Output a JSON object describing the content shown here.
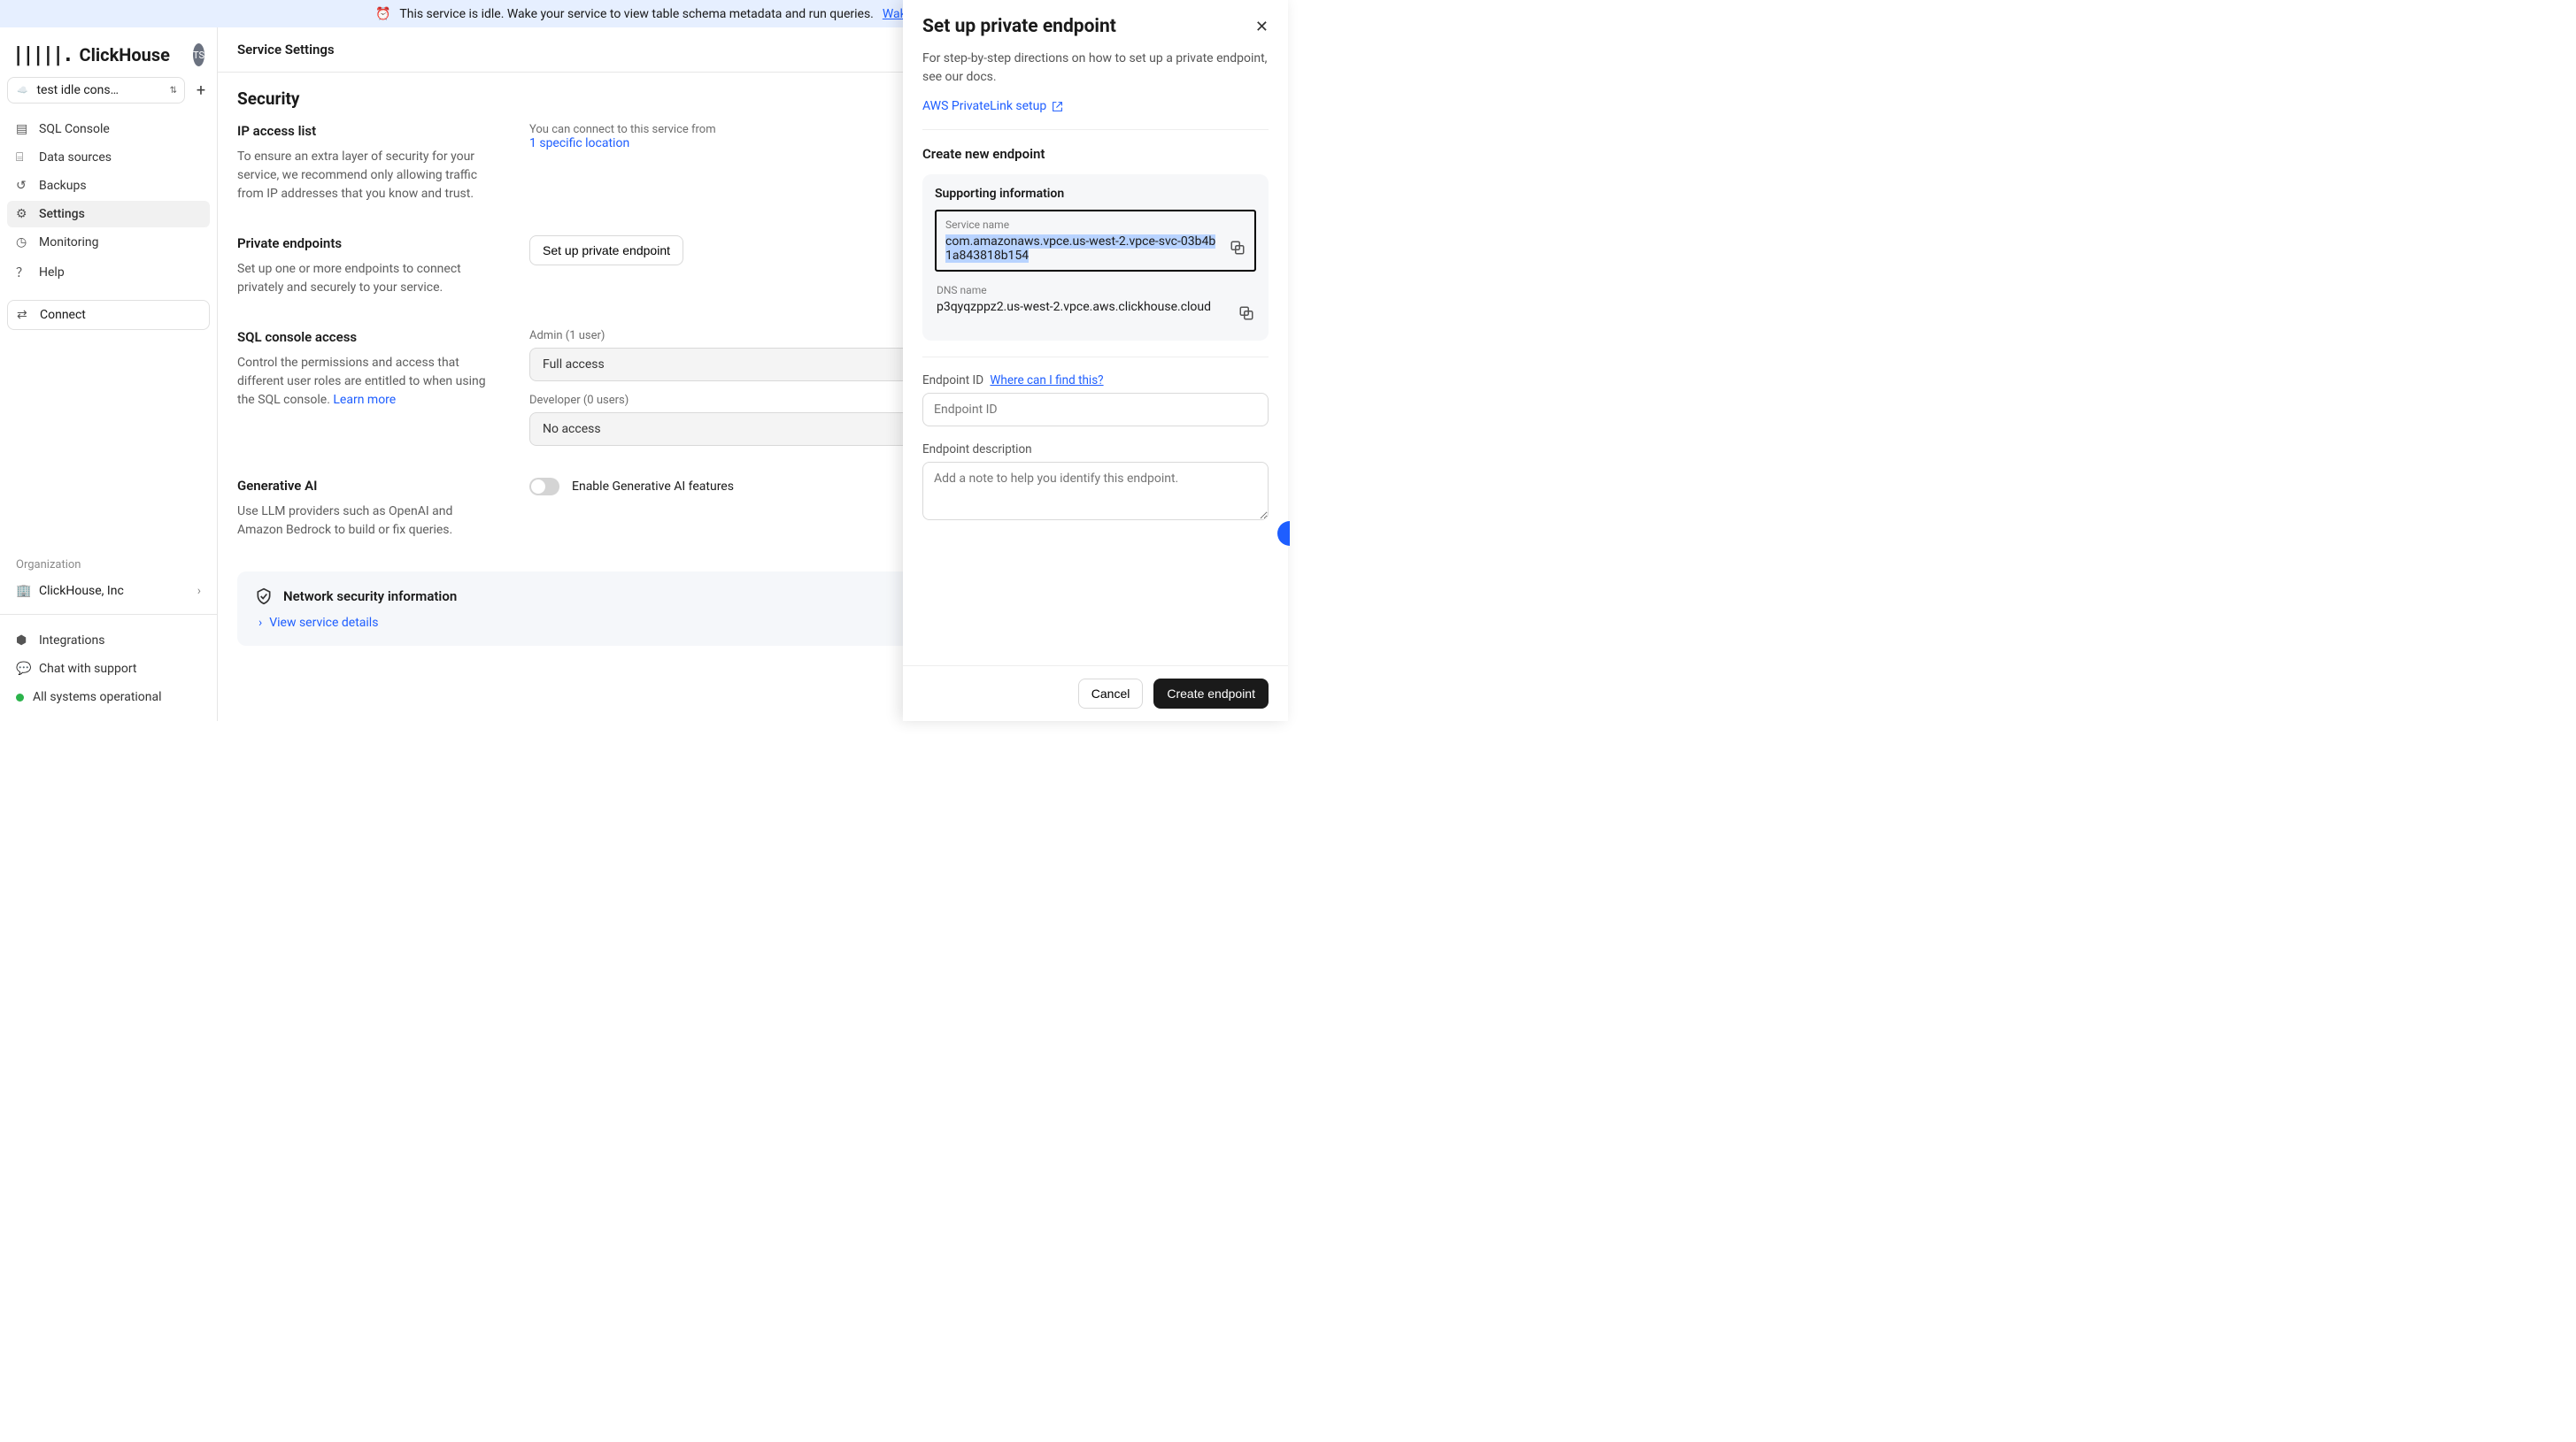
{
  "banner": {
    "text": "This service is idle. Wake your service to view table schema metadata and run queries.",
    "wake_label": "Wake"
  },
  "brand": {
    "name": "ClickHouse",
    "avatar_initials": "TS"
  },
  "service_selector": {
    "cloud": "aws",
    "name": "test idle cons…"
  },
  "nav": {
    "sql_console": "SQL Console",
    "data_sources": "Data sources",
    "backups": "Backups",
    "settings": "Settings",
    "monitoring": "Monitoring",
    "help": "Help",
    "connect": "Connect"
  },
  "org": {
    "label": "Organization",
    "name": "ClickHouse, Inc"
  },
  "footer": {
    "integrations": "Integrations",
    "chat": "Chat with support",
    "status": "All systems operational"
  },
  "page": {
    "header": "Service Settings",
    "security": "Security",
    "ip_access": {
      "title": "IP access list",
      "desc": "To ensure an extra layer of security for your service, we recommend only allowing traffic from IP addresses that you know and trust.",
      "connect_hint": "You can connect to this service from",
      "locations_link": "1 specific location"
    },
    "private_endpoints": {
      "title": "Private endpoints",
      "desc": "Set up one or more endpoints to connect privately and securely to your service.",
      "button": "Set up private endpoint"
    },
    "sql_access": {
      "title": "SQL console access",
      "desc": "Control the permissions and access that different user roles are entitled to when using the SQL console. ",
      "learn_more": "Learn more",
      "admin_label": "Admin (1 user)",
      "admin_value": "Full access",
      "dev_label": "Developer (0 users)",
      "dev_value": "No access"
    },
    "generative_ai": {
      "title": "Generative AI",
      "desc": "Use LLM providers such as OpenAI and Amazon Bedrock to build or fix queries.",
      "toggle_label": "Enable Generative AI features"
    },
    "net_sec": {
      "title": "Network security information",
      "view": "View service details"
    }
  },
  "drawer": {
    "title": "Set up private endpoint",
    "desc": "For step-by-step directions on how to set up a private endpoint, see our docs.",
    "link": "AWS PrivateLink setup",
    "create_heading": "Create new endpoint",
    "support": {
      "title": "Supporting information",
      "service_name_label": "Service name",
      "service_name": "com.amazonaws.vpce.us-west-2.vpce-svc-03b4b1a843818b154",
      "dns_label": "DNS name",
      "dns": "p3qyqzppz2.us-west-2.vpce.aws.clickhouse.cloud"
    },
    "endpoint_id": {
      "label": "Endpoint ID",
      "help": "Where can I find this?",
      "placeholder": "Endpoint ID"
    },
    "endpoint_desc": {
      "label": "Endpoint description",
      "placeholder": "Add a note to help you identify this endpoint."
    },
    "cancel": "Cancel",
    "create": "Create endpoint"
  }
}
